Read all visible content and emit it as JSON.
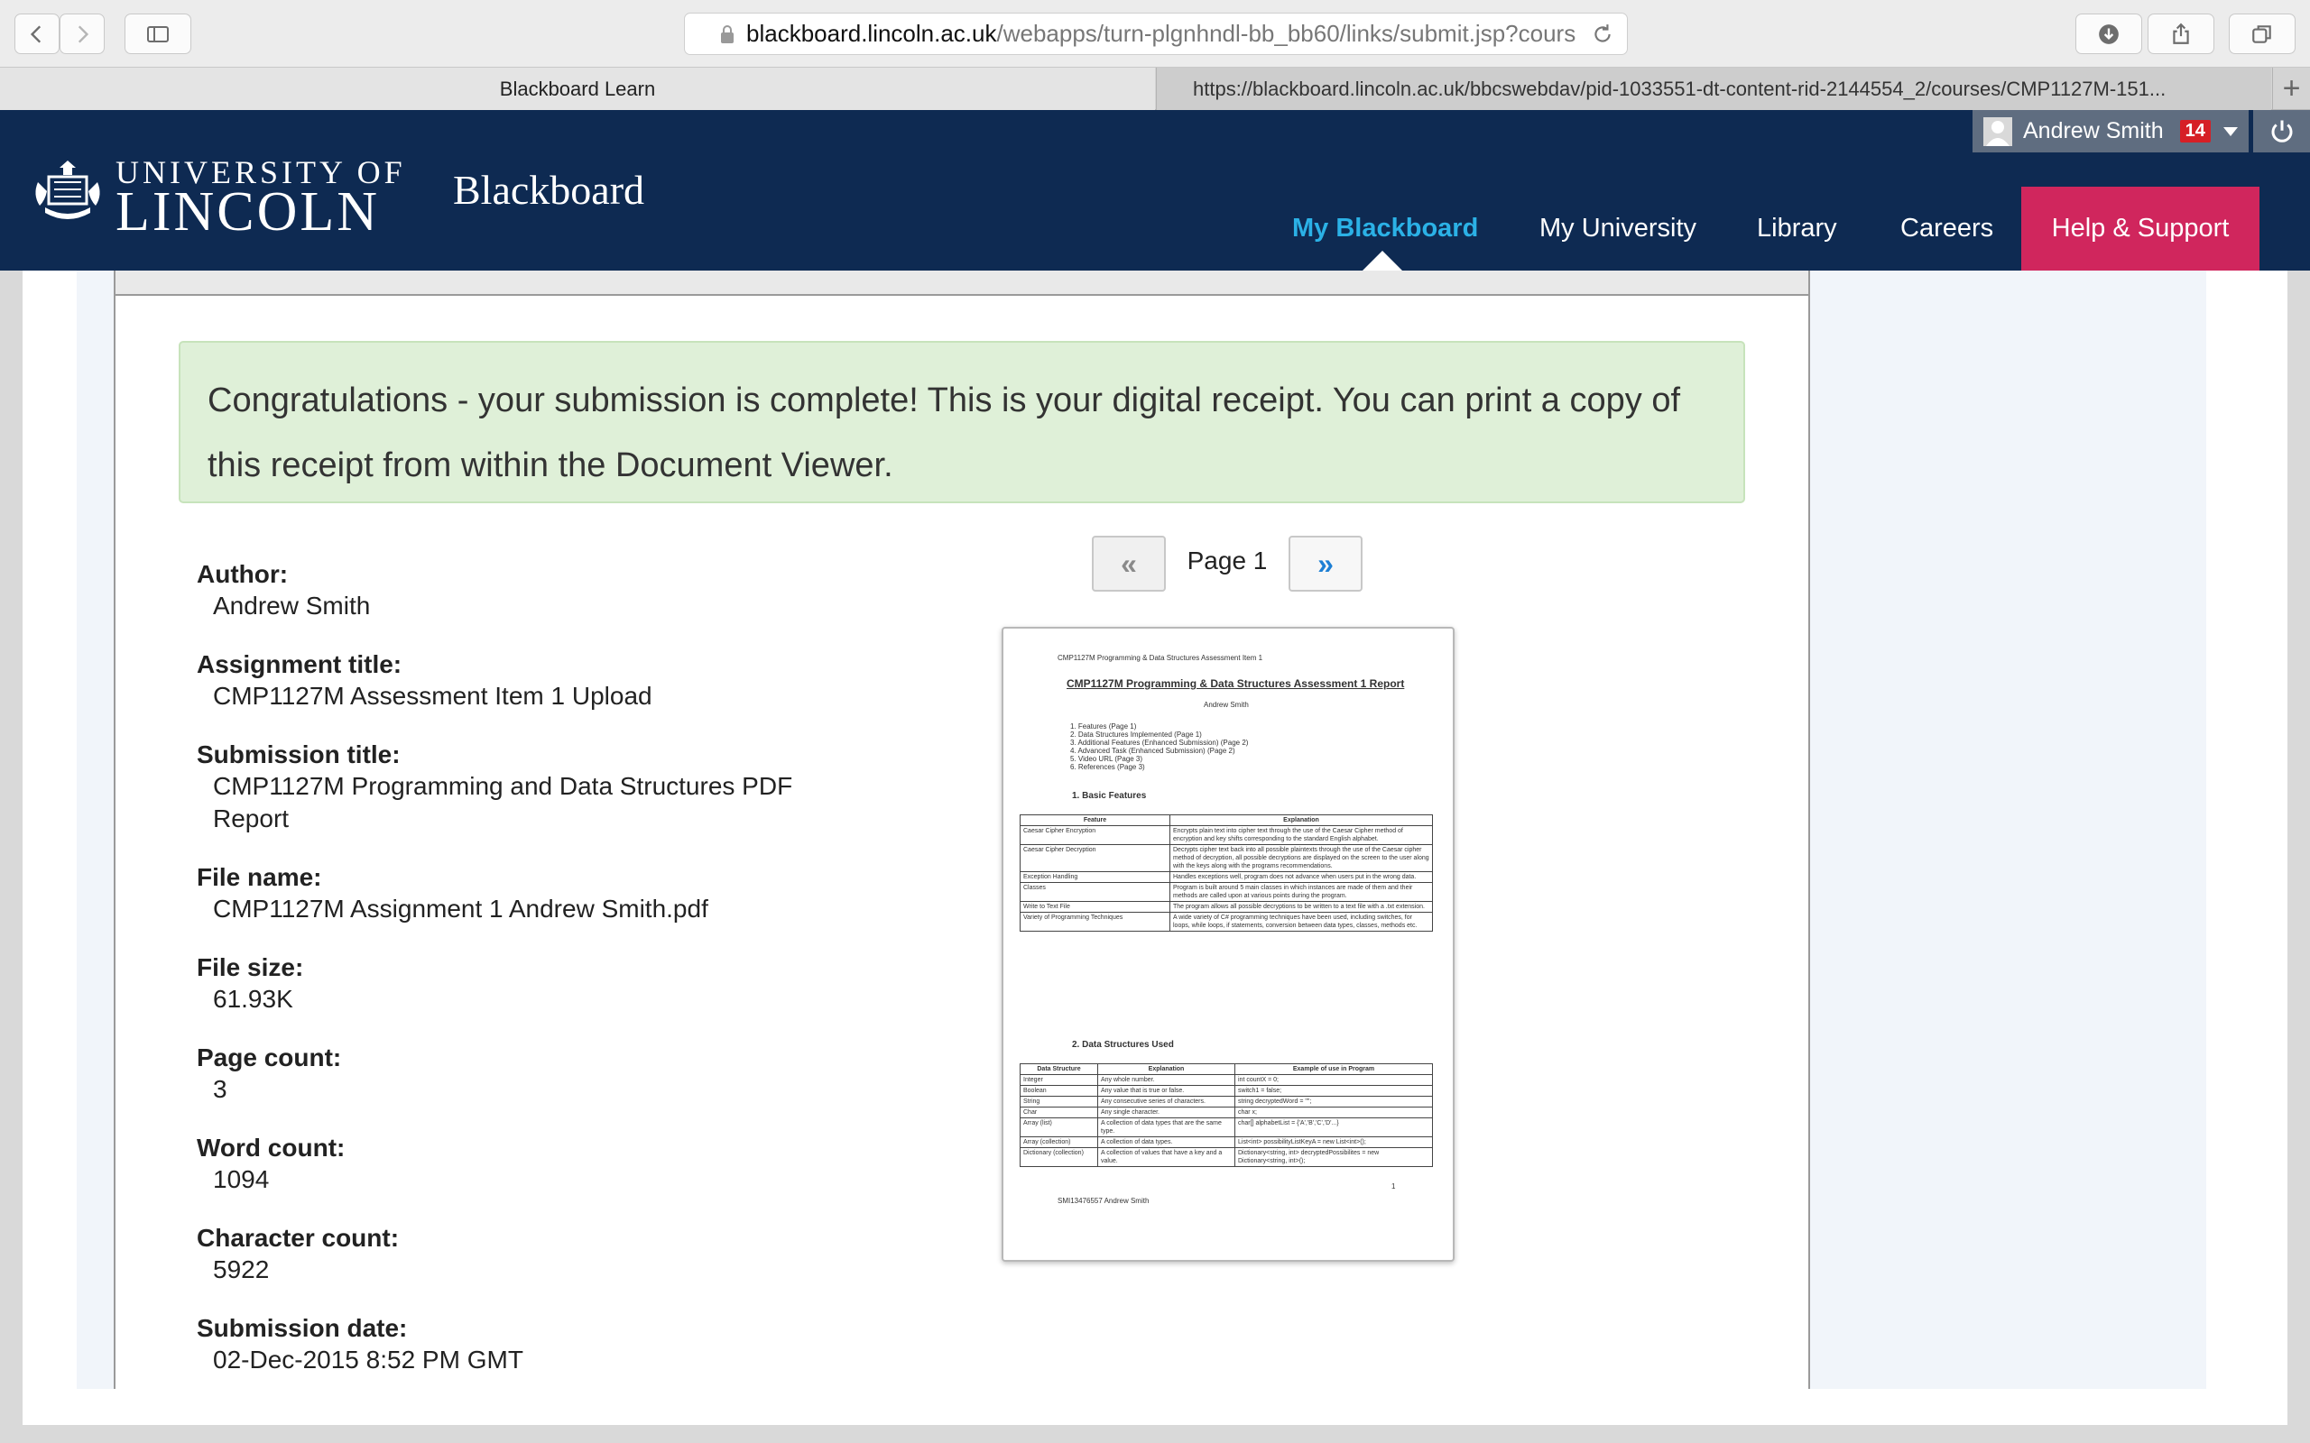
{
  "browser": {
    "url_domain": "blackboard.lincoln.ac.uk",
    "url_path": "/webapps/turn-plgnhndl-bb_bb60/links/submit.jsp?cours",
    "tabs": [
      {
        "label": "Blackboard Learn",
        "active": true
      },
      {
        "label": "https://blackboard.lincoln.ac.uk/bbcswebdav/pid-1033551-dt-content-rid-2144554_2/courses/CMP1127M-151...",
        "active": false
      }
    ],
    "new_tab": "+"
  },
  "header": {
    "university_line1": "UNIVERSITY OF",
    "university_line2": "LINCOLN",
    "product": "Blackboard",
    "user_name": "Andrew Smith",
    "notification_count": "14",
    "nav": [
      {
        "label": "My Blackboard",
        "active": true
      },
      {
        "label": "My University"
      },
      {
        "label": "Library"
      },
      {
        "label": "Careers"
      },
      {
        "label": "Help & Support"
      }
    ],
    "colors": {
      "header_bg": "#0e2a52",
      "active_nav": "#2bb1e6",
      "help_bg": "#d0265d",
      "badge": "#d61f26"
    }
  },
  "receipt": {
    "message": "Congratulations - your submission is complete! This is your digital receipt. You can print a copy of this receipt from within the Document Viewer.",
    "fields": [
      {
        "label": "Author:",
        "value": "Andrew Smith"
      },
      {
        "label": "Assignment title:",
        "value": "CMP1127M Assessment Item 1 Upload"
      },
      {
        "label": "Submission title:",
        "value": "CMP1127M Programming and Data Structures PDF Report"
      },
      {
        "label": "File name:",
        "value": "CMP1127M Assignment 1 Andrew Smith.pdf"
      },
      {
        "label": "File size:",
        "value": "61.93K"
      },
      {
        "label": "Page count:",
        "value": "3"
      },
      {
        "label": "Word count:",
        "value": "1094"
      },
      {
        "label": "Character count:",
        "value": "5922"
      },
      {
        "label": "Submission date:",
        "value": "02-Dec-2015 8:52 PM GMT"
      }
    ],
    "pager": {
      "prev": "«",
      "label": "Page 1",
      "next": "»"
    }
  },
  "document": {
    "running_header": "CMP1127M Programming & Data Structures Assessment Item 1",
    "title": "CMP1127M Programming & Data Structures Assessment 1 Report",
    "author": "Andrew Smith",
    "toc": [
      "1.   Features (Page 1)",
      "2.   Data Structures Implemented (Page 1)",
      "3.   Additional Features (Enhanced Submission) (Page 2)",
      "4.   Advanced Task (Enhanced Submission) (Page 2)",
      "5.   Video URL (Page 3)",
      "6.   References (Page 3)"
    ],
    "section1": "1.  Basic Features",
    "table1_headers": [
      "Feature",
      "Explanation"
    ],
    "table1_rows": [
      [
        "Caesar Cipher Encryption",
        "Encrypts plain text into cipher text through the use of the Caesar Cipher method of encryption and key shifts corresponding to the standard English alphabet."
      ],
      [
        "Caesar Cipher Decryption",
        "Decrypts cipher text back into all possible plaintexts through the use of the Caesar cipher method of decryption, all possible decryptions are displayed on the screen to the user along with the keys along with the programs recommendations."
      ],
      [
        "Exception Handling",
        "Handles exceptions well, program does not advance when users put in the wrong data."
      ],
      [
        "Classes",
        "Program is built around 5 main classes in which instances are made of them and their methods are called upon at various points during the program."
      ],
      [
        "Write to Text File",
        "The program allows all possible decryptions to be written to a text file with a .txt extension."
      ],
      [
        "Variety of Programming Techniques",
        "A wide variety of C# programming techniques have been used, including switches, for loops, while loops, if statements, conversion between data types, classes, methods etc."
      ]
    ],
    "section2": "2.  Data Structures Used",
    "table2_headers": [
      "Data Structure",
      "Explanation",
      "Example of use in Program"
    ],
    "table2_rows": [
      [
        "Integer",
        "Any whole number.",
        "int countX = 0;"
      ],
      [
        "Boolean",
        "Any value that is true or false.",
        "switch1 = false;"
      ],
      [
        "String",
        "Any consecutive series of characters.",
        "string decryptedWord = \"\";"
      ],
      [
        "Char",
        "Any single character.",
        "char x;"
      ],
      [
        "Array (list)",
        "A collection of data types that are the same type.",
        "char[] alphabetList = {'A','B','C','D'...}"
      ],
      [
        "Array (collection)",
        "A collection of data types.",
        "List<int> possibilityListKeyA = new List<int>();"
      ],
      [
        "Dictionary (collection)",
        "A collection of values that have a key and a value.",
        "Dictionary<string, int> decryptedPossibilites = new Dictionary<string, int>();"
      ]
    ],
    "page_number": "1",
    "footer": "SMI13476557 Andrew Smith"
  }
}
